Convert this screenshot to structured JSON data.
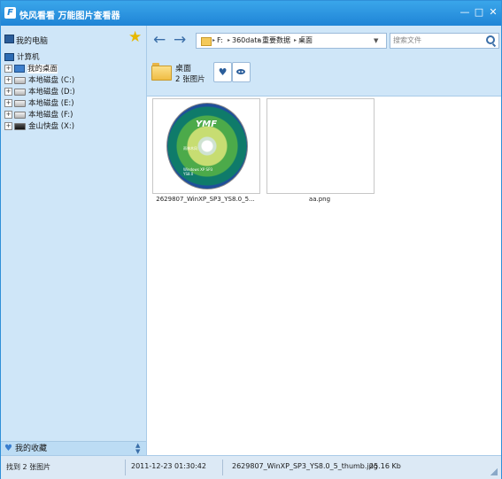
{
  "window": {
    "title": "快风看看 万能图片查看器",
    "app_icon_letter": "F",
    "controls": [
      "—",
      "□",
      "✕"
    ]
  },
  "sidebar": {
    "title": "我的电脑",
    "tree": {
      "root": "计算机",
      "items": [
        {
          "label": "我的桌面",
          "type": "desktop",
          "selected": true
        },
        {
          "label": "本地磁盘 (C:)",
          "type": "drive"
        },
        {
          "label": "本地磁盘 (D:)",
          "type": "drive"
        },
        {
          "label": "本地磁盘 (E:)",
          "type": "drive"
        },
        {
          "label": "本地磁盘 (F:)",
          "type": "drive"
        },
        {
          "label": "金山快盘 (X:)",
          "type": "usb"
        }
      ],
      "expander": "+"
    },
    "favorites_label": "我的收藏"
  },
  "toolbar": {
    "back_icon": "←",
    "forward_icon": "→",
    "path": [
      "F:",
      "360data",
      "重要数据",
      "桌面"
    ],
    "path_separator": "▸",
    "path_dropdown": "▼",
    "search_placeholder": "搜索文件",
    "folder_name": "桌面",
    "folder_count": "2 张图片",
    "favorite_icon": "♥"
  },
  "thumbnails": [
    {
      "filename": "2629807_WinXP_SP3_YS8.0_5...",
      "image": {
        "logo": "YMF",
        "line1": "雨林木风",
        "line2": "Windows XP SP3",
        "line3": "YS8.0"
      }
    },
    {
      "filename": "aa.png"
    }
  ],
  "status": {
    "found": "找到 2 张图片",
    "date": "2011-12-23 01:30:42",
    "selected_file": "2629807_WinXP_SP3_YS8.0_5_thumb.jpg",
    "size": "25.16 Kb"
  },
  "colors": {
    "titlebar": "#1f84d6",
    "sidebar_bg": "#cfe6f8",
    "accent": "#3a6ea8",
    "folder": "#f0bd45"
  }
}
